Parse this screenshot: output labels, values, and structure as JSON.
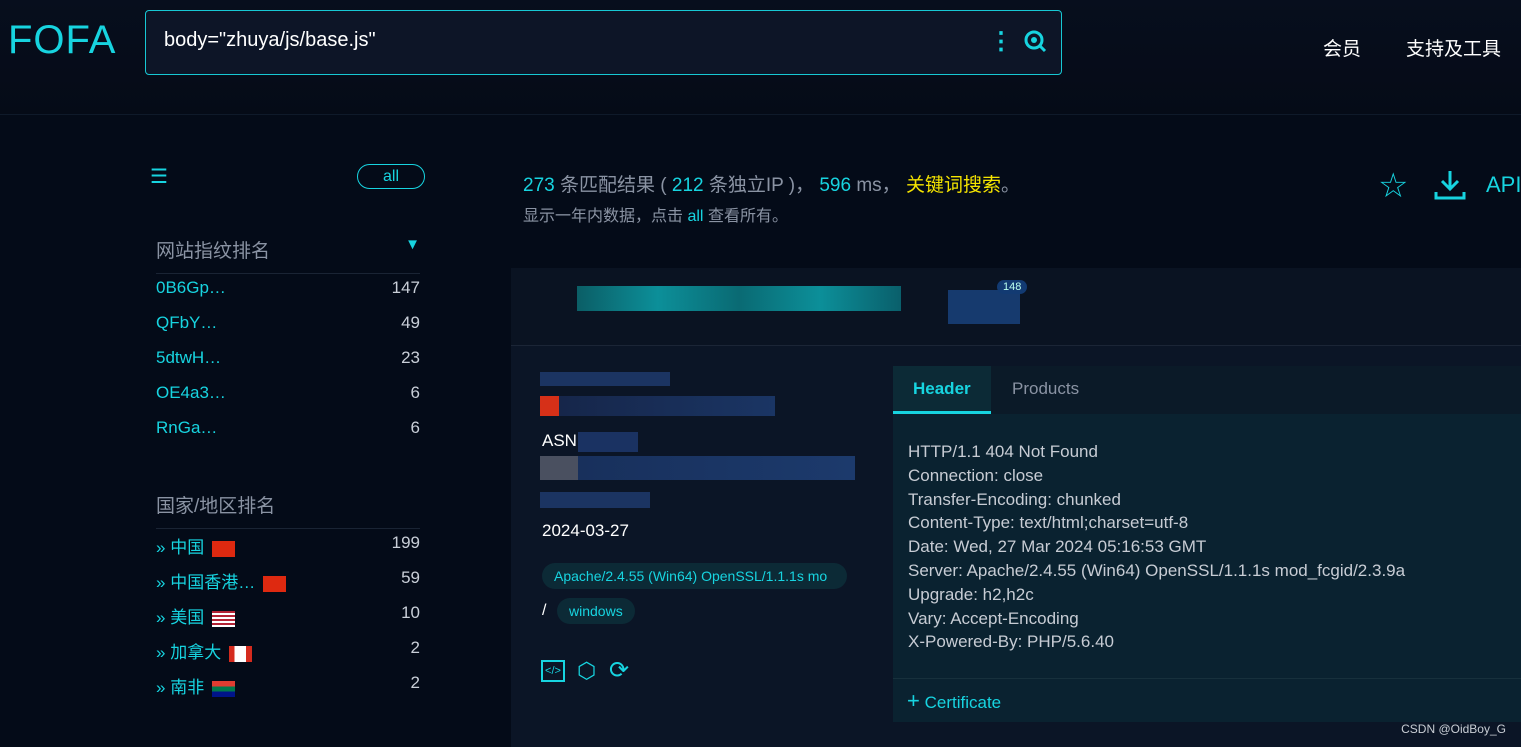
{
  "header": {
    "logo": "FOFA",
    "query": "body=\"zhuya/js/base.js\"",
    "nav": [
      "会员",
      "支持及工具"
    ]
  },
  "sidebar": {
    "all_label": "all",
    "fingerprint_title": "网站指纹排名",
    "fingerprints": [
      {
        "k": "0B6Gp…",
        "v": "147"
      },
      {
        "k": "QFbY…",
        "v": "49"
      },
      {
        "k": "5dtwH…",
        "v": "23"
      },
      {
        "k": "OE4a3…",
        "v": "6"
      },
      {
        "k": "RnGa…",
        "v": "6"
      }
    ],
    "country_title": "国家/地区排名",
    "countries": [
      {
        "k": "中国",
        "v": "199",
        "flag": "cn"
      },
      {
        "k": "中国香港…",
        "v": "59",
        "flag": "hk"
      },
      {
        "k": "美国",
        "v": "10",
        "flag": "us"
      },
      {
        "k": "加拿大",
        "v": "2",
        "flag": "ca"
      },
      {
        "k": "南非",
        "v": "2",
        "flag": "za"
      }
    ]
  },
  "summary": {
    "count": "273",
    "count_label": "条匹配结果 (",
    "ip": "212",
    "ip_label": "条独立IP )，",
    "ms": "596",
    "ms_label": "ms，",
    "keyword": "关键词搜索",
    "period": "。",
    "note_pre": "显示一年内数据，点击",
    "note_link": "all",
    "note_post": "查看所有。",
    "api": "API"
  },
  "result": {
    "badge": "148",
    "asn_prefix": "ASN",
    "date": "2024-03-27",
    "server_tag": "Apache/2.4.55 (Win64) OpenSSL/1.1.1s mo",
    "slash": "/",
    "os_tag": "windows",
    "tabs": [
      "Header",
      "Products"
    ],
    "header_text": "HTTP/1.1 404 Not Found\nConnection: close\nTransfer-Encoding: chunked\nContent-Type: text/html;charset=utf-8\nDate: Wed, 27 Mar 2024 05:16:53 GMT\nServer: Apache/2.4.55 (Win64) OpenSSL/1.1.1s mod_fcgid/2.3.9a\nUpgrade: h2,h2c\nVary: Accept-Encoding\nX-Powered-By: PHP/5.6.40",
    "certificate": "Certificate"
  },
  "watermark": "CSDN @OidBoy_G",
  "colors": {
    "accent": "#17d4e0",
    "keyword": "#f5e400"
  }
}
